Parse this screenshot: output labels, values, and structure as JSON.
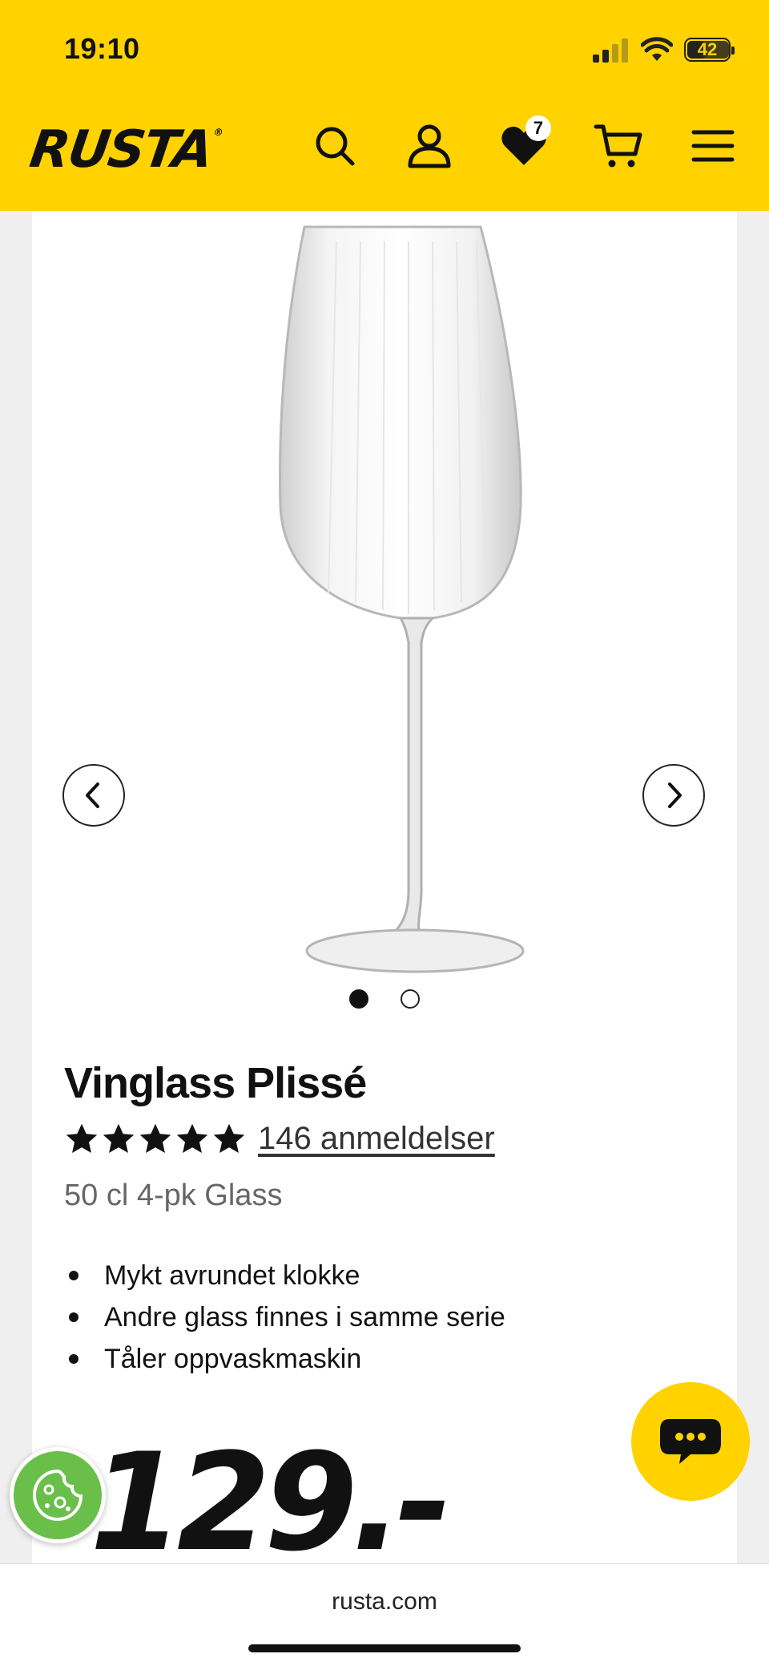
{
  "status_bar": {
    "time": "19:10",
    "battery": "42"
  },
  "header": {
    "logo": "RUSTA",
    "wishlist_count": "7",
    "icons": [
      "search-icon",
      "user-icon",
      "heart-icon",
      "cart-icon",
      "menu-icon"
    ]
  },
  "gallery": {
    "image_count": 2,
    "active_index": 0
  },
  "product": {
    "title": "Vinglass Plissé",
    "rating": 5,
    "reviews": "146 anmeldelser",
    "subtitle": "50 cl 4-pk Glass",
    "features": [
      "Mykt avrundet klokke",
      "Andre glass finnes i samme serie",
      "Tåler oppvaskmaskin"
    ],
    "price": "129.-"
  },
  "browser": {
    "url": "rusta.com"
  },
  "colors": {
    "brand_yellow": "#ffd200",
    "cookie_green": "#6abf4b"
  }
}
